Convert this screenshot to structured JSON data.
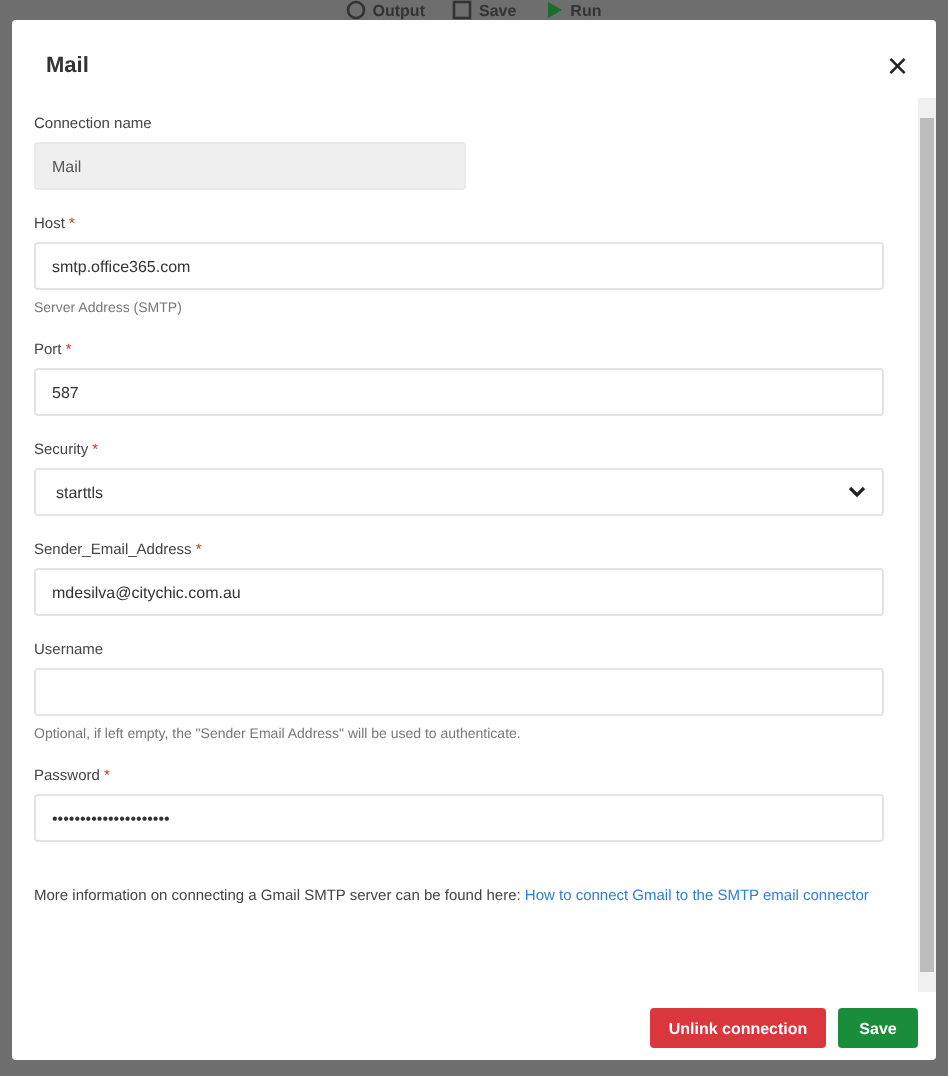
{
  "toolbar": [
    {
      "kind": "output",
      "label": "Output"
    },
    {
      "kind": "save",
      "label": "Save"
    },
    {
      "kind": "run",
      "label": "Run"
    }
  ],
  "dialog": {
    "title": "Mail",
    "close": "×",
    "fields": [
      {
        "kind": "text",
        "label": "Connection name",
        "value": "Mail",
        "disabled": true,
        "short": true
      },
      {
        "kind": "text",
        "label": "Host",
        "required_mark": "*",
        "value": "smtp.office365.com",
        "hint": "Server Address (SMTP)",
        "disabled": false
      },
      {
        "kind": "text",
        "label": "Port",
        "required_mark": "*",
        "value": "587",
        "disabled": false
      },
      {
        "kind": "select",
        "label": "Security",
        "required_mark": "*",
        "value": "starttls",
        "disabled": false
      },
      {
        "kind": "text",
        "label": "Sender_Email_Address",
        "required_mark": "*",
        "value": "mdesilva@citychic.com.au",
        "disabled": false
      },
      {
        "kind": "text",
        "label": "Username",
        "hint": "Optional, if left empty, the \"Sender Email Address\" will be used to authenticate.",
        "disabled": false
      },
      {
        "kind": "password",
        "label": "Password",
        "required_mark": "*",
        "value": "•••••••••••••••••••••",
        "disabled": false
      }
    ],
    "info": {
      "text": "More information on connecting a Gmail SMTP server can be found here:",
      "link": "How to connect Gmail to the SMTP email connector"
    },
    "buttons": [
      {
        "kind": "danger",
        "label": "Unlink connection"
      },
      {
        "kind": "primary",
        "label": "Save"
      }
    ]
  }
}
